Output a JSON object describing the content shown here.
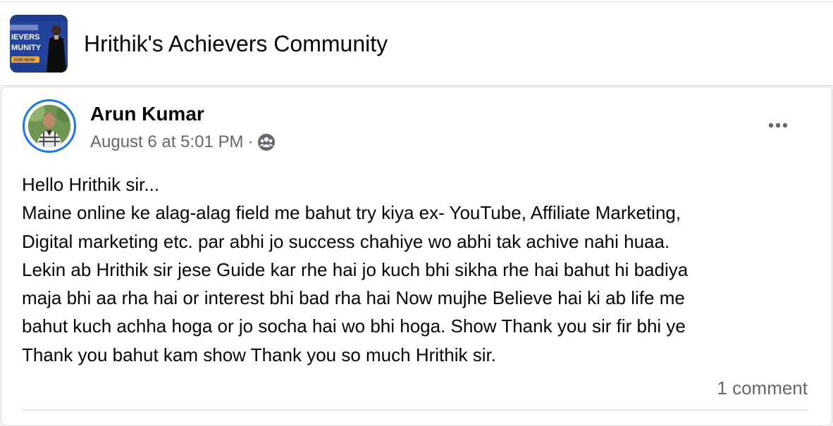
{
  "group": {
    "name": "Hrithik's Achievers Community",
    "thumbnail_text": [
      "IEVERS",
      "MUNITY",
      "JOIN NOW"
    ],
    "thumbnail_colors": {
      "bg": "#1d3c8f",
      "accent": "#f5a623"
    }
  },
  "post": {
    "author": "Arun Kumar",
    "timestamp": "August 6 at 5:01 PM",
    "separator": "·",
    "audience_icon": "group-members-icon",
    "more_icon": "more-options-icon",
    "body_lines": [
      "Hello Hrithik sir...",
      "Maine online ke alag-alag field me bahut try kiya ex- YouTube, Affiliate Marketing,",
      "Digital marketing etc. par abhi jo success chahiye wo abhi tak achive nahi huaa.",
      "Lekin ab Hrithik sir jese Guide kar rhe hai jo kuch bhi sikha rhe hai bahut hi badiya",
      "maja bhi aa rha hai or interest bhi bad rha hai Now mujhe Believe hai ki ab life me",
      "bahut kuch achha hoga or jo socha hai wo bhi hoga. Show Thank you sir fir bhi ye",
      "Thank you bahut kam show Thank you so much Hrithik sir."
    ],
    "comment_count": "1 comment"
  },
  "colors": {
    "accent": "#1877f2",
    "secondary_text": "#65676b",
    "primary_text": "#050505"
  }
}
